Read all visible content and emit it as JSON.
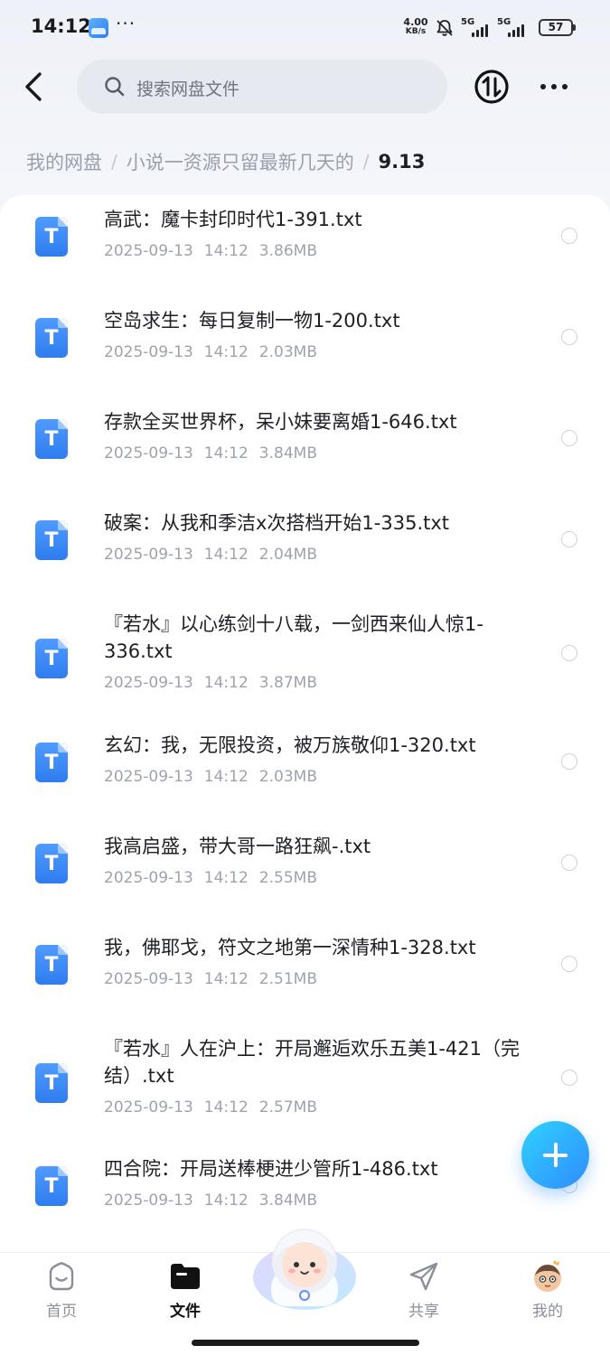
{
  "status_bar": {
    "time": "14:12",
    "dots": "···",
    "net_speed_value": "4.00",
    "net_speed_unit": "KB/s",
    "sim1": "5G",
    "sim2": "5G",
    "battery": "57"
  },
  "header": {
    "search_placeholder": "搜索网盘文件"
  },
  "breadcrumb": {
    "root": "我的网盘",
    "parent": "小说一资源只留最新几天的",
    "current": "9.13",
    "separator": "/"
  },
  "files": [
    {
      "icon_letter": "T",
      "name": "高武：魔卡封印时代1-391.txt",
      "date": "2025-09-13",
      "time": "14:12",
      "size": "3.86MB"
    },
    {
      "icon_letter": "T",
      "name": "空岛求生：每日复制一物1-200.txt",
      "date": "2025-09-13",
      "time": "14:12",
      "size": "2.03MB"
    },
    {
      "icon_letter": "T",
      "name": "存款全买世界杯，呆小妹要离婚1-646.txt",
      "date": "2025-09-13",
      "time": "14:12",
      "size": "3.84MB"
    },
    {
      "icon_letter": "T",
      "name": "破案：从我和季洁x次搭档开始1-335.txt",
      "date": "2025-09-13",
      "time": "14:12",
      "size": "2.04MB"
    },
    {
      "icon_letter": "T",
      "name": "『若水』以心练剑十八载，一剑西来仙人惊1-336.txt",
      "date": "2025-09-13",
      "time": "14:12",
      "size": "3.87MB"
    },
    {
      "icon_letter": "T",
      "name": "玄幻：我，无限投资，被万族敬仰1-320.txt",
      "date": "2025-09-13",
      "time": "14:12",
      "size": "2.03MB"
    },
    {
      "icon_letter": "T",
      "name": "我高启盛，带大哥一路狂飙-.txt",
      "date": "2025-09-13",
      "time": "14:12",
      "size": "2.55MB"
    },
    {
      "icon_letter": "T",
      "name": "我，佛耶戈，符文之地第一深情种1-328.txt",
      "date": "2025-09-13",
      "time": "14:12",
      "size": "2.51MB"
    },
    {
      "icon_letter": "T",
      "name": "『若水』人在沪上：开局邂逅欢乐五美1-421（完结）.txt",
      "date": "2025-09-13",
      "time": "14:12",
      "size": "2.57MB"
    },
    {
      "icon_letter": "T",
      "name": "四合院：开局送棒梗进少管所1-486.txt",
      "date": "2025-09-13",
      "time": "14:12",
      "size": "3.84MB"
    }
  ],
  "bottom_nav": {
    "home": "首页",
    "files": "文件",
    "share": "共享",
    "mine": "我的",
    "active": "files"
  },
  "colors": {
    "accent": "#2f7cf0",
    "fab_gradient_start": "#2fd2ff",
    "fab_gradient_end": "#2f8cff",
    "file_icon": "#3f8cf7"
  },
  "icons": {
    "back": "chevron-left-icon",
    "search": "search-icon",
    "transfer": "transfer-icon",
    "more": "more-dots-icon",
    "fab": "plus-icon"
  }
}
